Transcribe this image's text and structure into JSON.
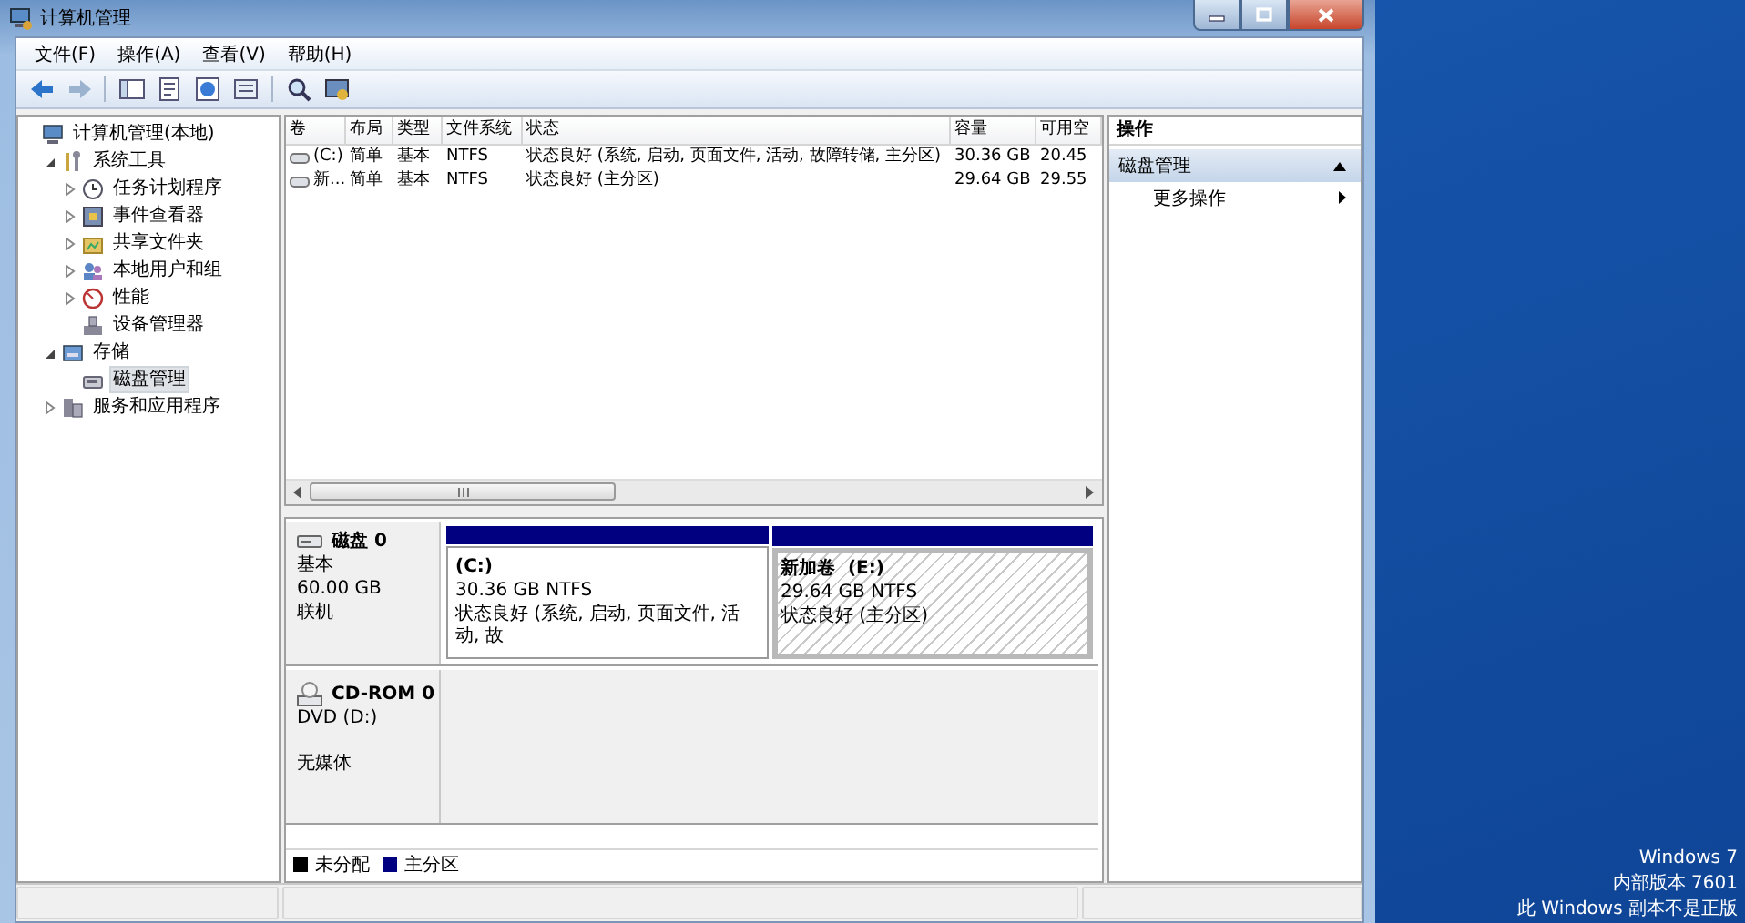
{
  "window": {
    "title": "计算机管理"
  },
  "menu": [
    "文件(F)",
    "操作(A)",
    "查看(V)",
    "帮助(H)"
  ],
  "tree": [
    {
      "label": "计算机管理(本地)",
      "selected": false,
      "children": [
        {
          "label": "系统工具",
          "expanded": true,
          "selected": false,
          "children": [
            {
              "label": "任务计划程序",
              "expanded": false,
              "selected": false
            },
            {
              "label": "事件查看器",
              "expanded": false,
              "selected": false
            },
            {
              "label": "共享文件夹",
              "expanded": false,
              "selected": false
            },
            {
              "label": "本地用户和组",
              "expanded": false,
              "selected": false
            },
            {
              "label": "性能",
              "expanded": false,
              "selected": false
            },
            {
              "label": "设备管理器",
              "selected": false
            }
          ]
        },
        {
          "label": "存储",
          "expanded": true,
          "selected": false,
          "children": [
            {
              "label": "磁盘管理",
              "selected": true
            }
          ]
        },
        {
          "label": "服务和应用程序",
          "expanded": false,
          "selected": false
        }
      ]
    }
  ],
  "table": {
    "columns": [
      "卷",
      "布局",
      "类型",
      "文件系统",
      "状态",
      "容量",
      "可用空"
    ],
    "rows": [
      [
        "(C:)",
        "简单",
        "基本",
        "NTFS",
        "状态良好 (系统, 启动, 页面文件, 活动, 故障转储, 主分区)",
        "30.36 GB",
        "20.45"
      ],
      [
        "新...",
        "简单",
        "基本",
        "NTFS",
        "状态良好 (主分区)",
        "29.64 GB",
        "29.55"
      ]
    ]
  },
  "disks": [
    {
      "kind": "disk",
      "name": "磁盘 0",
      "lines": [
        "基本",
        "60.00 GB",
        "联机"
      ],
      "partitions": [
        {
          "title": "(C:)",
          "size": "30.36 GB NTFS",
          "status": "状态良好 (系统, 启动, 页面文件, 活动, 故",
          "selected": false
        },
        {
          "title": "新加卷  (E:)",
          "size": "29.64 GB NTFS",
          "status": "状态良好 (主分区)",
          "selected": true
        }
      ]
    },
    {
      "kind": "cdrom",
      "name": "CD-ROM 0",
      "lines": [
        "DVD (D:)",
        "无媒体"
      ]
    }
  ],
  "legend": [
    {
      "label": "未分配",
      "color": "#000000"
    },
    {
      "label": "主分区",
      "color": "#000080"
    }
  ],
  "actions": {
    "header": "操作",
    "sections": [
      {
        "title": "磁盘管理",
        "expanded": true,
        "items": [
          "更多操作"
        ]
      }
    ]
  },
  "desktop_notice": [
    "Windows 7",
    "内部版本 7601",
    "此 Windows 副本不是正版"
  ]
}
